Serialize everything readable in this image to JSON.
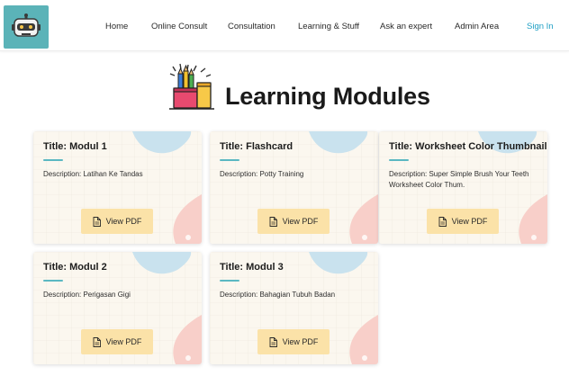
{
  "nav": {
    "links": [
      {
        "label": "Home"
      },
      {
        "label": "Online Consult"
      },
      {
        "label": "Consultation"
      },
      {
        "label": "Learning & Stuff"
      },
      {
        "label": "Ask an expert"
      },
      {
        "label": "Admin Area"
      },
      {
        "label": "Sign In"
      }
    ],
    "logo_icon": "robot-icon"
  },
  "page": {
    "title": "Learning Modules",
    "header_icon": "pencil-cup-icon"
  },
  "colors": {
    "accent": "#5bb3b8",
    "link_active": "#1f9fc4",
    "button_bg": "#fbe2a8",
    "card_bg": "#fbf7ef"
  },
  "modules": [
    {
      "title": "Title: Modul 1",
      "description": "Description: Latihan Ke Tandas",
      "button": "View PDF"
    },
    {
      "title": "Title: Flashcard",
      "description": "Description: Potty Training",
      "button": "View PDF"
    },
    {
      "title": "Title: Worksheet Color Thumbnail",
      "description": "Description: Super Simple Brush Your Teeth Worksheet Color Thum.",
      "button": "View PDF"
    },
    {
      "title": "Title: Modul 2",
      "description": "Description: Perigasan Gigi",
      "button": "View PDF"
    },
    {
      "title": "Title: Modul 3",
      "description": "Description: Bahagian Tubuh Badan",
      "button": "View PDF"
    }
  ]
}
